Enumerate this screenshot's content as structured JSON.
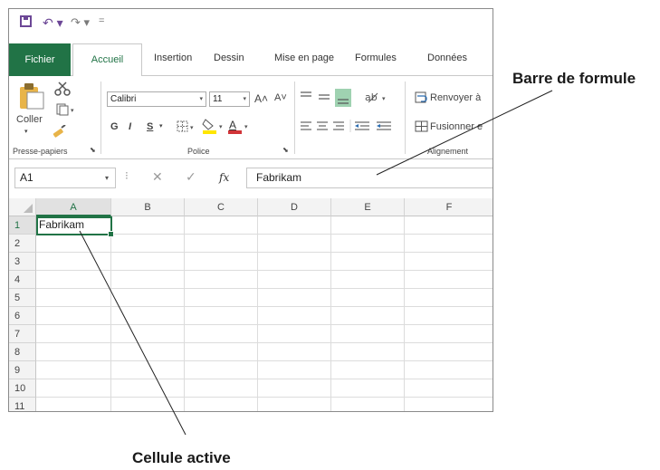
{
  "qat": {
    "save_icon": "save-icon",
    "undo_icon": "↶ ▾",
    "redo_icon": "↷ ▾",
    "customize_icon": "="
  },
  "tabs": {
    "file": "Fichier",
    "home": "Accueil",
    "insert": "Insertion",
    "draw": "Dessin",
    "layout": "Mise en page",
    "formulas": "Formules",
    "data": "Données"
  },
  "ribbon": {
    "clipboard": {
      "paste": "Coller",
      "group": "Presse-papiers"
    },
    "font": {
      "name": "Calibri",
      "size": "11",
      "bold": "G",
      "italic": "I",
      "underline": "S",
      "grow": "A˄",
      "shrink": "A˅",
      "group": "Police"
    },
    "alignment": {
      "wrap": "Renvoyer à",
      "merge": "Fusionner e",
      "group": "Alignement"
    }
  },
  "formula_bar": {
    "name_box": "A1",
    "cancel": "✕",
    "enter": "✓",
    "fx": "fx",
    "value": "Fabrikam"
  },
  "grid": {
    "columns": [
      "A",
      "B",
      "C",
      "D",
      "E",
      "F"
    ],
    "rows": [
      "1",
      "2",
      "3",
      "4",
      "5",
      "6",
      "7",
      "8",
      "9",
      "10",
      "11"
    ],
    "cell_a1": "Fabrikam"
  },
  "callouts": {
    "formula_bar": "Barre de formule",
    "active_cell": "Cellule active"
  },
  "colors": {
    "excel_green": "#217346",
    "paste_yellow": "#e8b449",
    "font_color_red": "#d13438",
    "fill_yellow": "#ffe600"
  }
}
